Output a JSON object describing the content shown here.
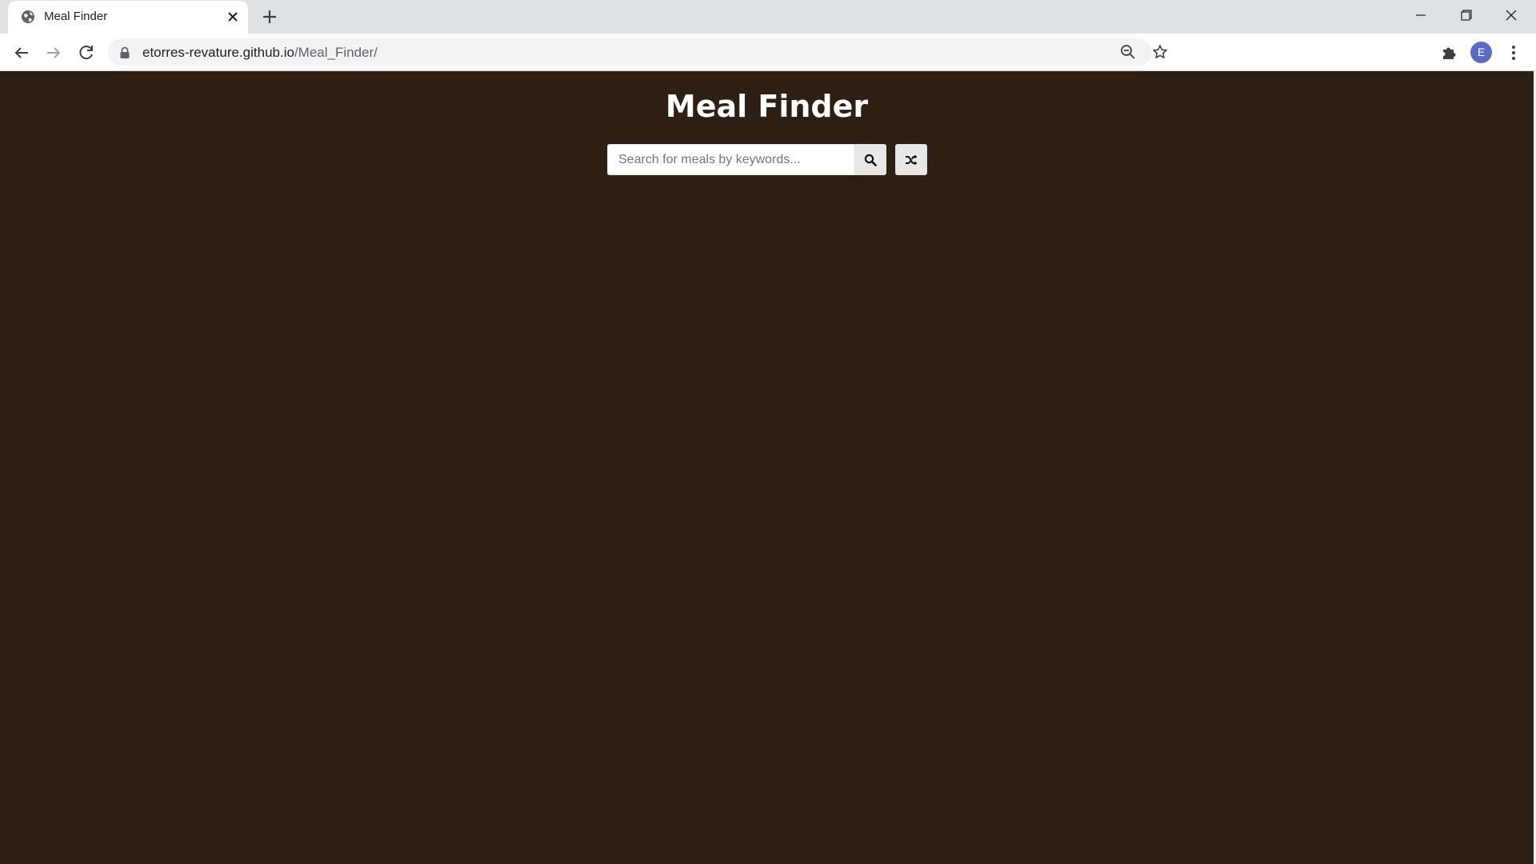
{
  "browser": {
    "tab": {
      "title": "Meal Finder"
    },
    "address": {
      "host": "etorres-revature.github.io",
      "path": "/Meal_Finder/"
    },
    "profile_initial": "E"
  },
  "page": {
    "title": "Meal Finder",
    "search": {
      "placeholder": "Search for meals by keywords...",
      "value": ""
    }
  },
  "icons": {
    "search_button": "search-icon",
    "random_button": "random-shuffle-icon"
  },
  "colors": {
    "page_background": "#2d1f14",
    "title_text": "#ffffff",
    "button_background": "#e8e8e8"
  }
}
